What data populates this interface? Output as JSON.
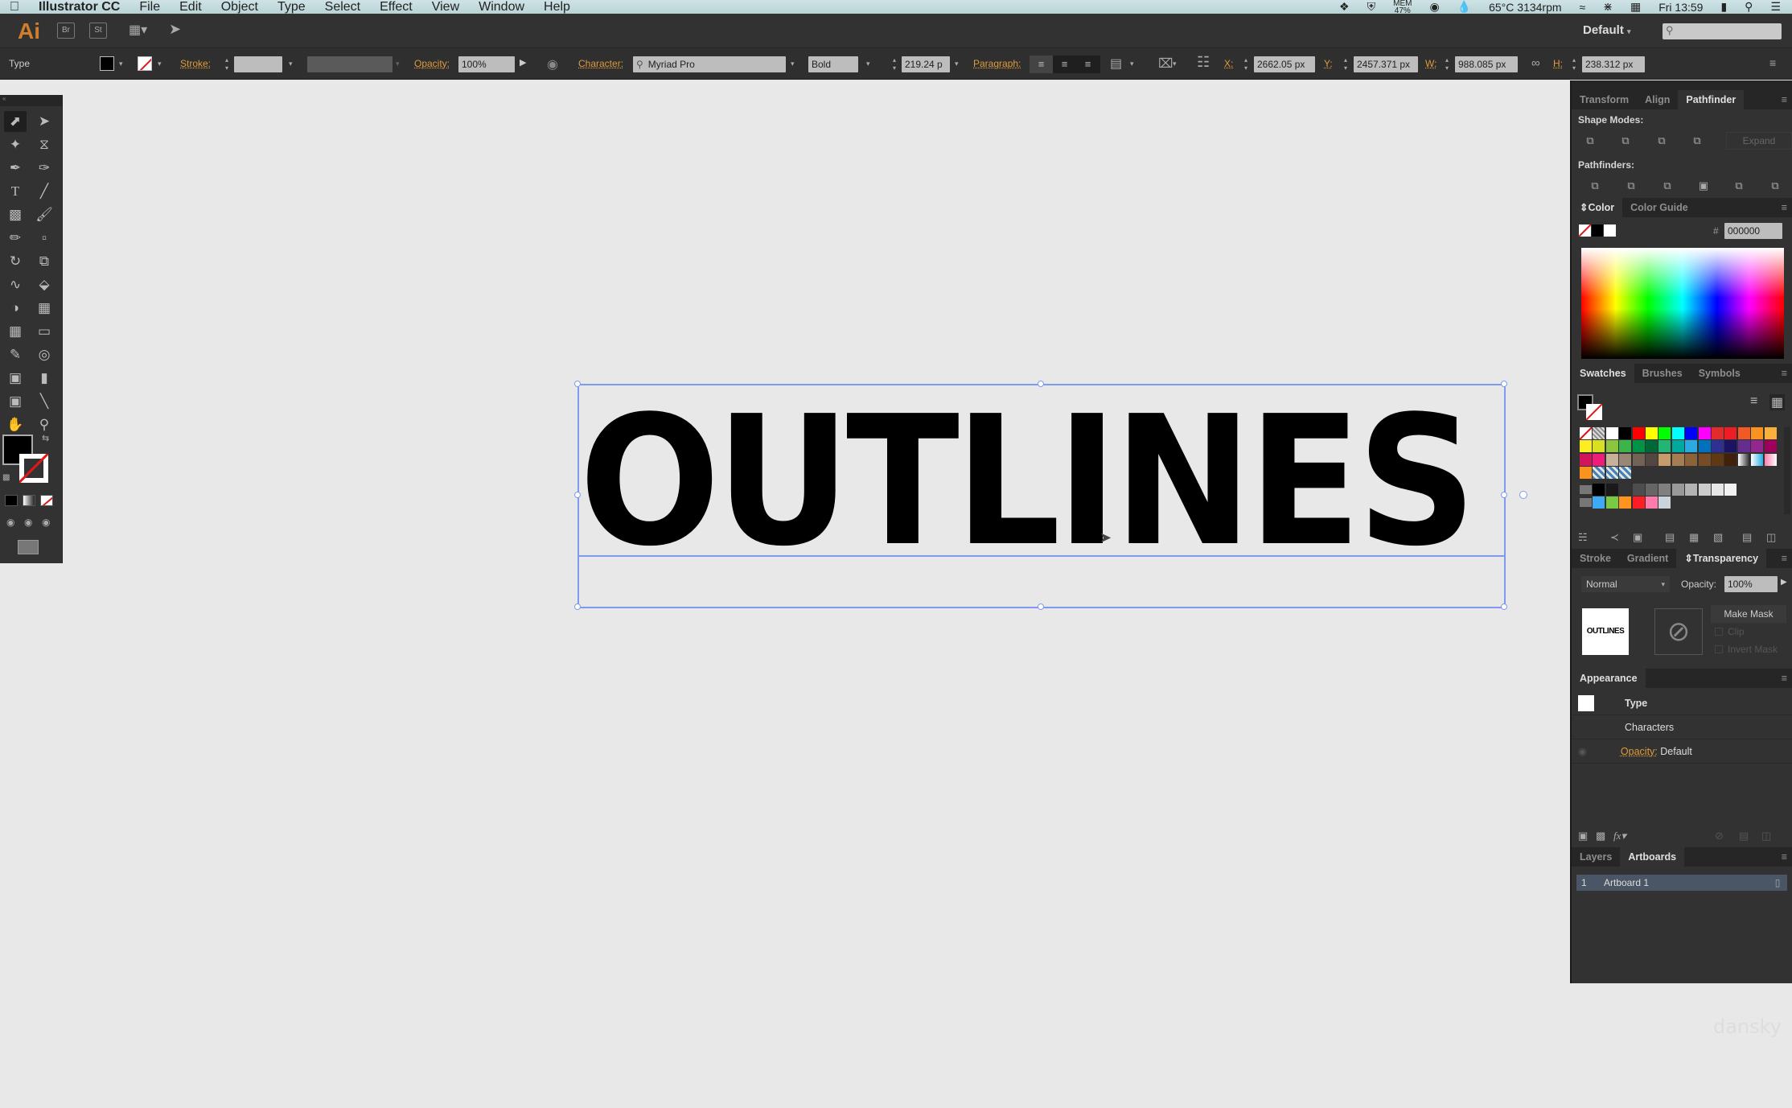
{
  "menubar": {
    "apple_icon": "apple-icon",
    "app_name": "Illustrator CC",
    "menus": [
      "File",
      "Edit",
      "Object",
      "Type",
      "Select",
      "Effect",
      "View",
      "Window",
      "Help"
    ],
    "status": {
      "memory_label": "MEM",
      "memory_value": "47%",
      "temperature": "65°C 3134rpm",
      "clock": "Fri 13:59"
    }
  },
  "appbar": {
    "logo": "Ai",
    "bridge_label": "Br",
    "stock_label": "St",
    "workspace": "Default",
    "search_placeholder": ""
  },
  "controlbar": {
    "selection_type": "Type",
    "fill_color": "#000000",
    "stroke_label": "Stroke:",
    "opacity_label": "Opacity:",
    "opacity_value": "100%",
    "character_label": "Character:",
    "font_family": "Myriad Pro",
    "font_style": "Bold",
    "font_size": "219.24 p",
    "paragraph_label": "Paragraph:",
    "x_label": "X:",
    "x_value": "2662.05 px",
    "y_label": "Y:",
    "y_value": "2457.371 px",
    "w_label": "W:",
    "w_value": "988.085 px",
    "h_label": "H:",
    "h_value": "238.312 px"
  },
  "canvas": {
    "text": "OUTLINES",
    "text_color": "#000000",
    "selection_color": "#7e9aef"
  },
  "panels": {
    "pathfinder": {
      "tabs": [
        "Transform",
        "Align",
        "Pathfinder"
      ],
      "active_tab": "Pathfinder",
      "shape_modes_label": "Shape Modes:",
      "expand_label": "Expand",
      "pathfinders_label": "Pathfinders:"
    },
    "color": {
      "tabs": [
        "Color",
        "Color Guide"
      ],
      "hash_label": "#",
      "hex_value": "000000"
    },
    "swatches": {
      "tabs": [
        "Swatches",
        "Brushes",
        "Symbols"
      ],
      "rows": [
        [
          "none",
          "registration",
          "#ffffff",
          "#000000",
          "#ff0000",
          "#ffff00",
          "#00ff00",
          "#00ffff",
          "#0000ff",
          "#ff00ff",
          "#e32b2b",
          "#ee1c25",
          "#f15a24",
          "#f7931e",
          "#fbb03b"
        ],
        [
          "#fcee21",
          "#d9e021",
          "#8cc63f",
          "#39b54a",
          "#009245",
          "#006837",
          "#22b573",
          "#00a99d",
          "#29abe2",
          "#0071bc",
          "#2e3192",
          "#1b1464",
          "#662d91",
          "#93278f",
          "#9e005d"
        ],
        [
          "#d4145a",
          "#ed1e79",
          "#c7b299",
          "#998675",
          "#736357",
          "#534741",
          "#c69c6d",
          "#a67c52",
          "#8c6239",
          "#754c24",
          "#603813",
          "#42210b",
          "gradient-bw",
          "gradient-blue",
          "gradient-pink"
        ],
        [
          "#f7931e",
          "pattern1",
          "pattern2",
          "pattern3"
        ]
      ],
      "gray_group": [
        "#000000",
        "#1a1a1a",
        "#333333",
        "#4d4d4d",
        "#666666",
        "#808080",
        "#999999",
        "#b3b3b3",
        "#cccccc",
        "#e6e6e6",
        "#f2f2f2"
      ],
      "color_group": [
        "#3fa9f5",
        "#7ac943",
        "#ff931e",
        "#ff1d25",
        "#ff7bac",
        "#c9d4dc"
      ]
    },
    "transparency": {
      "tabs": [
        "Stroke",
        "Gradient",
        "Transparency"
      ],
      "blend_mode": "Normal",
      "opacity_label": "Opacity:",
      "opacity_value": "100%",
      "thumbnail_text": "OUTLINES",
      "make_mask_label": "Make Mask",
      "clip_label": "Clip",
      "invert_mask_label": "Invert Mask"
    },
    "appearance": {
      "title": "Appearance",
      "rows": {
        "type": "Type",
        "characters": "Characters",
        "opacity_label": "Opacity:",
        "opacity_value": "Default"
      }
    },
    "layers": {
      "tabs": [
        "Layers",
        "Artboards"
      ],
      "active_tab": "Artboards",
      "artboards": [
        {
          "number": "1",
          "name": "Artboard 1"
        }
      ]
    }
  },
  "watermark": "dansky"
}
